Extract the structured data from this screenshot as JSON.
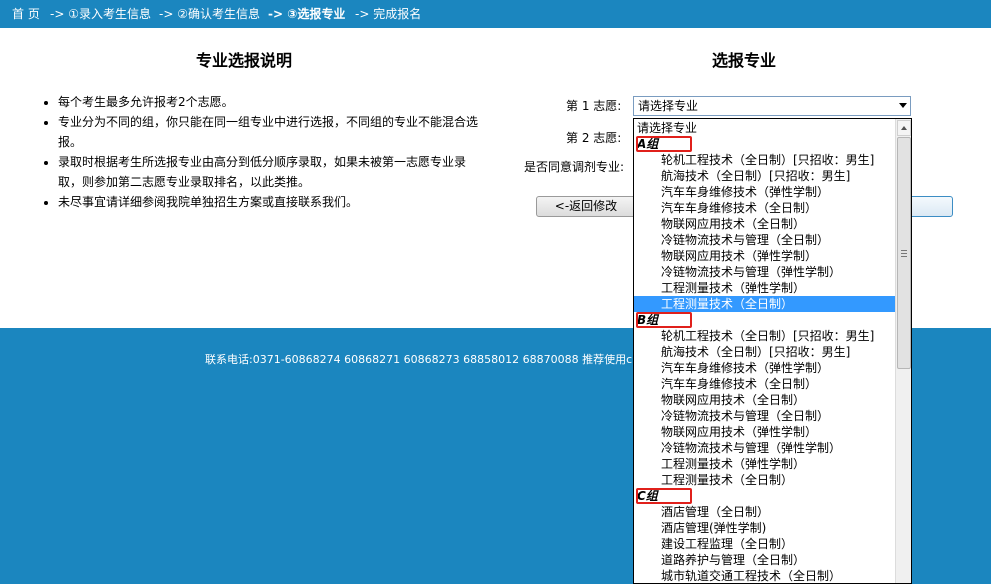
{
  "breadcrumb": {
    "items": [
      {
        "label": "首 页"
      },
      {
        "label": "-> ①录入考生信息"
      },
      {
        "label": "-> ②确认考生信息"
      },
      {
        "label": "-> ③选报专业"
      },
      {
        "label": "-> 完成报名"
      }
    ]
  },
  "left_panel": {
    "title": "专业选报说明",
    "notes": [
      "每个考生最多允许报考2个志愿。",
      "专业分为不同的组，你只能在同一组专业中进行选报，不同组的专业不能混合选报。",
      "录取时根据考生所选报专业由高分到低分顺序录取，如果未被第一志愿专业录取，则参加第二志愿专业录取排名，以此类推。",
      "未尽事宜请详细参阅我院单独招生方案或直接联系我们。"
    ]
  },
  "right_panel": {
    "title": "选报专业",
    "choice1_label": "第 1 志愿:",
    "choice1_value": "请选择专业",
    "choice2_label": "第 2 志愿:",
    "adjust_label": "是否同意调剂专业:",
    "back_button": "<-返回修改"
  },
  "footer": {
    "text": "联系电话:0371-60868274 60868271 60868273 68858012 68870088 推荐使用chrome浏览器"
  },
  "dropdown": {
    "placeholder": "请选择专业",
    "groups": [
      {
        "name": "A组",
        "options": [
          "轮机工程技术（全日制）[只招收：男生]",
          "航海技术（全日制）[只招收：男生]",
          "汽车车身维修技术（弹性学制）",
          "汽车车身维修技术（全日制）",
          "物联网应用技术（全日制）",
          "冷链物流技术与管理（全日制）",
          "物联网应用技术（弹性学制）",
          "冷链物流技术与管理（弹性学制）",
          "工程测量技术（弹性学制）",
          "工程测量技术（全日制）"
        ]
      },
      {
        "name": "B组",
        "options": [
          "轮机工程技术（全日制）[只招收：男生]",
          "航海技术（全日制）[只招收：男生]",
          "汽车车身维修技术（弹性学制）",
          "汽车车身维修技术（全日制）",
          "物联网应用技术（全日制）",
          "冷链物流技术与管理（全日制）",
          "物联网应用技术（弹性学制）",
          "冷链物流技术与管理（弹性学制）",
          "工程测量技术（弹性学制）",
          "工程测量技术（全日制）"
        ]
      },
      {
        "name": "C组",
        "options": [
          "酒店管理（全日制）",
          "酒店管理(弹性学制)",
          "建设工程监理（全日制）",
          "道路养护与管理（全日制）",
          "城市轨道交通工程技术（全日制）"
        ]
      }
    ],
    "highlighted": "工程测量技术（全日制）"
  },
  "colors": {
    "brand_blue": "#1b86bf",
    "highlight_blue": "#3399ff",
    "group_box_red": "#e0201b"
  }
}
